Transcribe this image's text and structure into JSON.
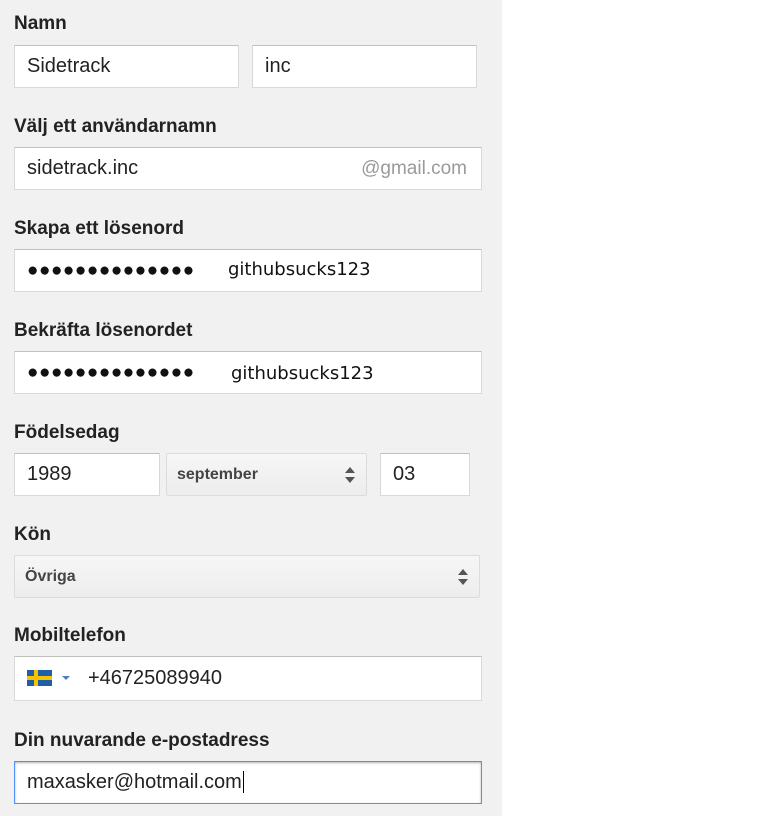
{
  "form": {
    "name": {
      "label": "Namn",
      "first_value": "Sidetrack",
      "last_value": "inc"
    },
    "username": {
      "label": "Välj ett användarnamn",
      "value": "sidetrack.inc",
      "suffix": "@gmail.com"
    },
    "password": {
      "label": "Skapa ett lösenord",
      "masked": "●●●●●●●●●●●●●●",
      "overlay_text": "githubsucks123"
    },
    "confirm_password": {
      "label": "Bekräfta lösenordet",
      "masked": "●●●●●●●●●●●●●●",
      "overlay_text": "githubsucks123"
    },
    "birthday": {
      "label": "Födelsedag",
      "year": "1989",
      "month": "september",
      "day": "03"
    },
    "gender": {
      "label": "Kön",
      "selected": "Övriga"
    },
    "phone": {
      "label": "Mobiltelefon",
      "country_icon": "sweden-flag-icon",
      "value": "+46725089940"
    },
    "current_email": {
      "label": "Din nuvarande e-postadress",
      "value": "maxasker@hotmail.com"
    }
  },
  "colors": {
    "panel_background": "#f1f1f1",
    "focus_border": "#4d90fe",
    "flag_blue": "#1f5fa8",
    "flag_yellow": "#f7c300"
  }
}
